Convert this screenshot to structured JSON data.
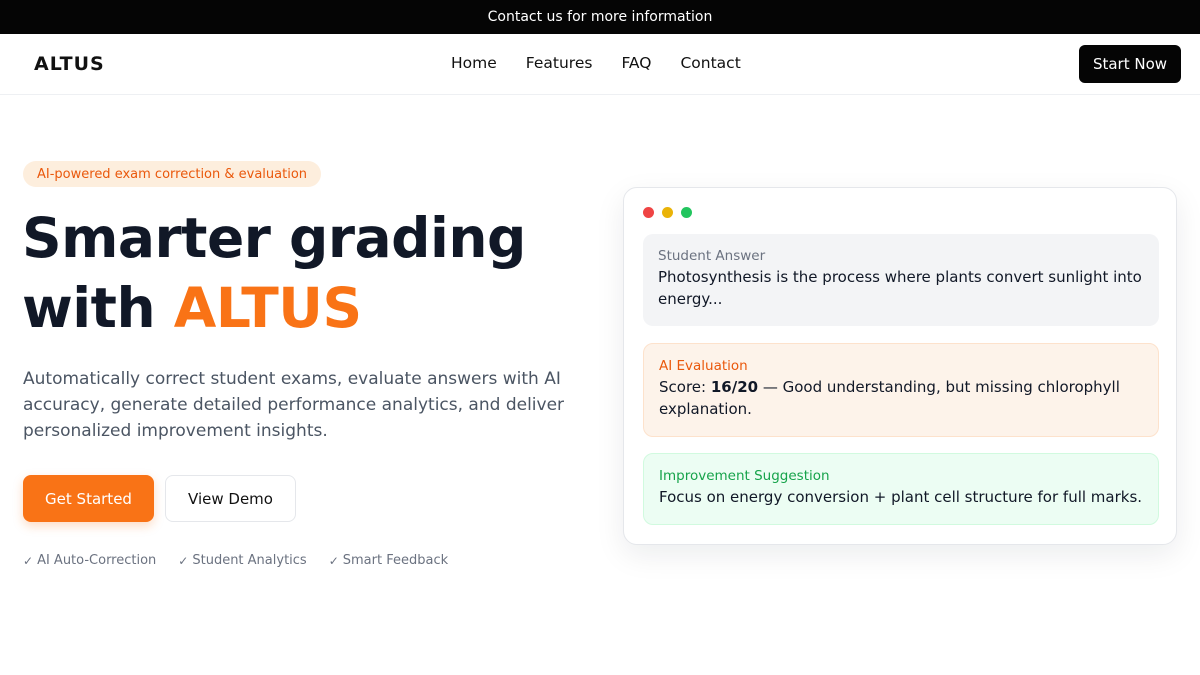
{
  "announcement": {
    "text": "Contact us for more information"
  },
  "nav": {
    "logo": "ALTUS",
    "links": [
      "Home",
      "Features",
      "FAQ",
      "Contact"
    ],
    "cta_label": "Start Now"
  },
  "hero": {
    "badge": "AI-powered exam correction & evaluation",
    "headline_line1": "Smarter grading",
    "headline_prefix": "with ",
    "headline_brand": "ALTUS",
    "subtitle": "Automatically correct student exams, evaluate answers with AI accuracy, generate detailed performance analytics, and deliver personalized improvement insights.",
    "primary_button": "Get Started",
    "secondary_button": "View Demo",
    "features": [
      "AI Auto-Correction",
      "Student Analytics",
      "Smart Feedback"
    ]
  },
  "preview_card": {
    "window_dots": [
      "#ef4444",
      "#eab308",
      "#22c55e"
    ],
    "student_answer": {
      "label": "Student Answer",
      "text": "Photosynthesis is the process where plants convert sunlight into energy..."
    },
    "ai_evaluation": {
      "label": "AI Evaluation",
      "score_label": "Score:",
      "score_value": "16/20",
      "comment": " — Good understanding, but missing chlorophyll explanation."
    },
    "improvement": {
      "label": "Improvement Suggestion",
      "text": "Focus on energy conversion + plant cell structure for full marks."
    }
  },
  "colors": {
    "accent": "#f97316",
    "dark": "#050505",
    "heading": "#111827"
  }
}
